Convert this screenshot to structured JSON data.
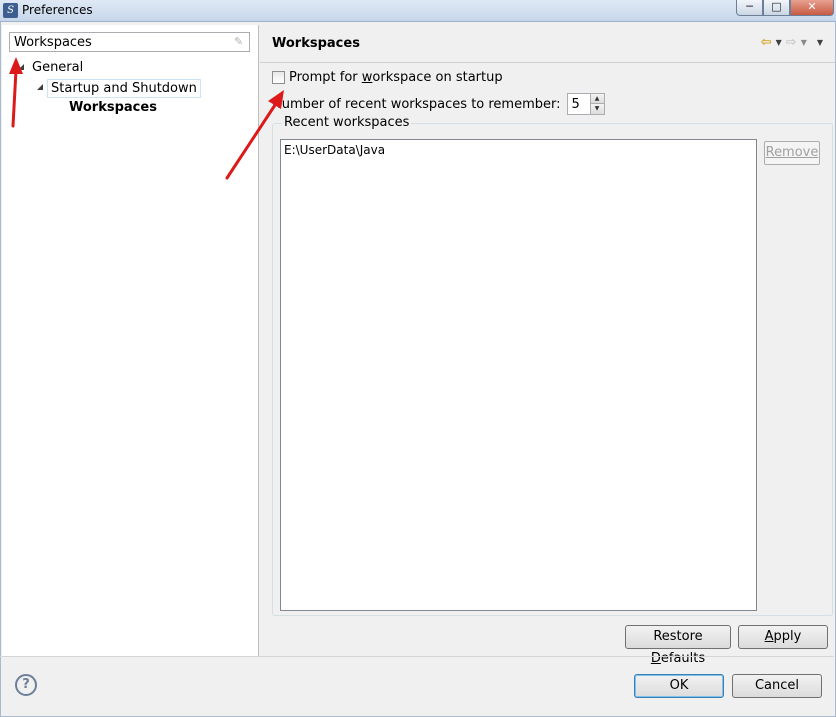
{
  "window": {
    "title": "Preferences",
    "minimize_glyph": "─",
    "maximize_glyph": "□",
    "close_glyph": "✕"
  },
  "filter": {
    "value": "Workspaces",
    "clear_icon": "eraser-icon"
  },
  "tree": {
    "items": [
      {
        "label": "General",
        "level": 0,
        "expanded": true
      },
      {
        "label": "Startup and Shutdown",
        "level": 1,
        "expanded": true
      },
      {
        "label": "Workspaces",
        "level": 2,
        "selected": true
      }
    ]
  },
  "page": {
    "title": "Workspaces",
    "nav_back_icon": "back-arrow-icon",
    "nav_forward_icon": "forward-arrow-icon",
    "prompt_checkbox": {
      "label_before": "Prompt for ",
      "label_mnemonic": "w",
      "label_after": "orkspace on startup",
      "checked": false
    },
    "recent_count": {
      "label": "Number of recent workspaces to remember:",
      "value": "5"
    },
    "recent_group": {
      "label": "Recent workspaces",
      "items": [
        "E:\\UserData\\Java"
      ],
      "remove_mnemonic": "R",
      "remove_rest": "emove"
    },
    "restore_defaults": {
      "before": "Restore ",
      "mnemonic": "D",
      "after": "efaults"
    },
    "apply": {
      "mnemonic": "A",
      "after": "pply"
    }
  },
  "footer": {
    "help_glyph": "?",
    "ok_label": "OK",
    "cancel_label": "Cancel"
  },
  "colors": {
    "annotation_arrow": "#dd1a1a",
    "selection_border": "#cce4f7",
    "default_button_border": "#3c7fb1"
  }
}
